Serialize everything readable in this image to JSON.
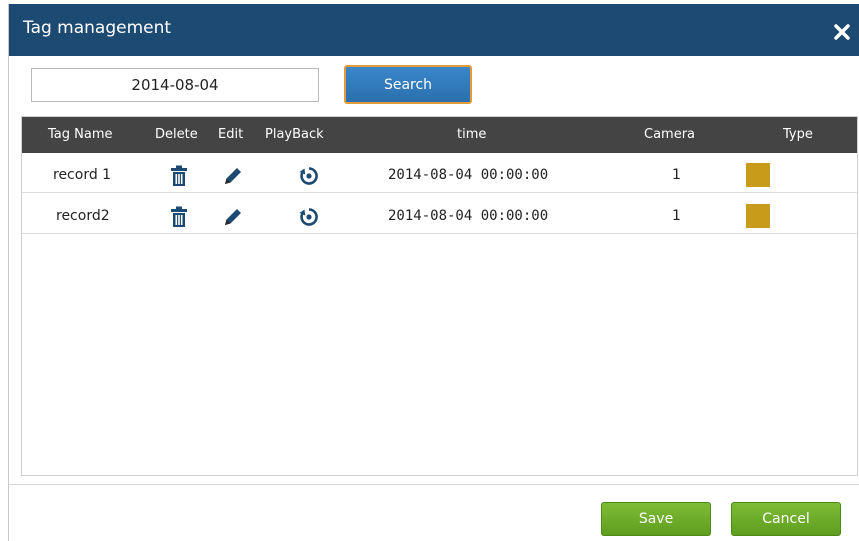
{
  "dialog": {
    "title": "Tag management"
  },
  "search": {
    "date_value": "2014-08-04",
    "button_label": "Search"
  },
  "table": {
    "columns": [
      "Tag Name",
      "Delete",
      "Edit",
      "PlayBack",
      "time",
      "Camera",
      "Type"
    ],
    "rows": [
      {
        "tag_name": "record 1",
        "time": "2014-08-04 00:00:00",
        "camera": "1",
        "type_color": "#c89b1a"
      },
      {
        "tag_name": "record2",
        "time": "2014-08-04 00:00:00",
        "camera": "1",
        "type_color": "#c89b1a"
      }
    ]
  },
  "footer": {
    "save_label": "Save",
    "cancel_label": "Cancel"
  },
  "colors": {
    "titlebar": "#1d4a72",
    "header_row": "#444444",
    "icon": "#1d4a72",
    "save_green": "#6aad26"
  }
}
